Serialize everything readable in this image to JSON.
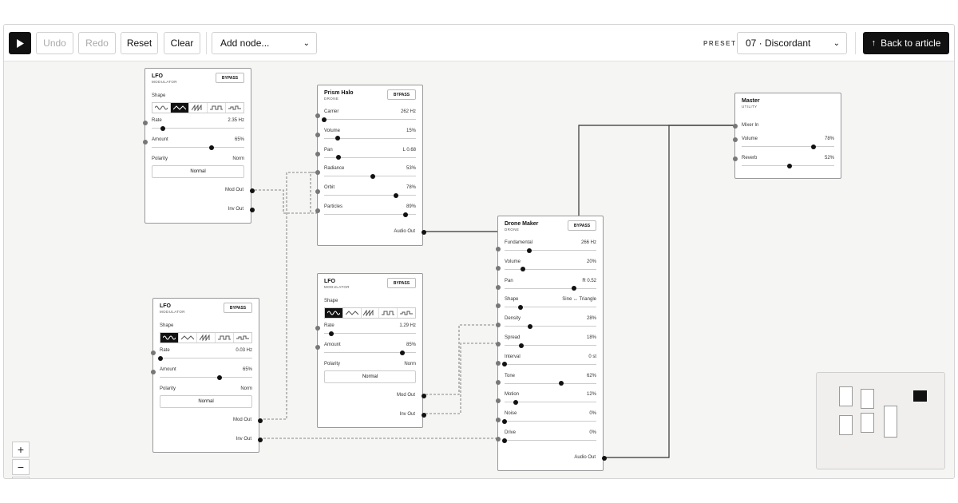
{
  "toolbar": {
    "play_icon": "play-icon",
    "undo": "Undo",
    "redo": "Redo",
    "reset": "Reset",
    "clear": "Clear",
    "add_node": "Add node...",
    "preset_label": "PRESET",
    "preset_value": "07 · Discordant",
    "back": "Back to article",
    "back_icon": "arrow-up-icon"
  },
  "common": {
    "bypass": "BYPASS"
  },
  "lfo1": {
    "title": "LFO",
    "subtitle": "MODULATOR",
    "shape_label": "Shape",
    "active_shape": 1,
    "params": [
      {
        "label": "Rate",
        "value": "2.35 Hz",
        "level": 0.12
      },
      {
        "label": "Amount",
        "value": "65%",
        "level": 0.65
      }
    ],
    "polarity_label": "Polarity",
    "polarity_value": "Norm",
    "mode": "Normal",
    "out1": "Mod Out",
    "out2": "Inv Out"
  },
  "lfo2": {
    "title": "LFO",
    "subtitle": "MODULATOR",
    "shape_label": "Shape",
    "active_shape": 0,
    "params": [
      {
        "label": "Rate",
        "value": "0.03 Hz",
        "level": 0.01
      },
      {
        "label": "Amount",
        "value": "65%",
        "level": 0.65
      }
    ],
    "polarity_label": "Polarity",
    "polarity_value": "Norm",
    "mode": "Normal",
    "out1": "Mod Out",
    "out2": "Inv Out"
  },
  "lfo3": {
    "title": "LFO",
    "subtitle": "MODULATOR",
    "shape_label": "Shape",
    "active_shape": 0,
    "params": [
      {
        "label": "Rate",
        "value": "1.29 Hz",
        "level": 0.08
      },
      {
        "label": "Amount",
        "value": "85%",
        "level": 0.85
      }
    ],
    "polarity_label": "Polarity",
    "polarity_value": "Norm",
    "mode": "Normal",
    "out1": "Mod Out",
    "out2": "Inv Out"
  },
  "prism": {
    "title": "Prism Halo",
    "subtitle": "DRONE",
    "params": [
      {
        "label": "Carrier",
        "value": "262 Hz",
        "level": 0.0
      },
      {
        "label": "Volume",
        "value": "15%",
        "level": 0.15
      },
      {
        "label": "Pan",
        "value": "L 0.68",
        "level": 0.16
      },
      {
        "label": "Radiance",
        "value": "53%",
        "level": 0.53
      },
      {
        "label": "Orbit",
        "value": "78%",
        "level": 0.78
      },
      {
        "label": "Particles",
        "value": "89%",
        "level": 0.89
      }
    ],
    "out": "Audio Out"
  },
  "drone": {
    "title": "Drone Maker",
    "subtitle": "DRONE",
    "params": [
      {
        "label": "Fundamental",
        "value": "266 Hz",
        "level": 0.27
      },
      {
        "label": "Volume",
        "value": "20%",
        "level": 0.2
      },
      {
        "label": "Pan",
        "value": "R 0.52",
        "level": 0.76
      },
      {
        "label": "Shape",
        "value": "Sine ↔ Triangle",
        "level": 0.17
      },
      {
        "label": "Density",
        "value": "28%",
        "level": 0.28
      },
      {
        "label": "Spread",
        "value": "18%",
        "level": 0.18
      },
      {
        "label": "Interval",
        "value": "0 st",
        "level": 0.0
      },
      {
        "label": "Tone",
        "value": "62%",
        "level": 0.62
      },
      {
        "label": "Motion",
        "value": "12%",
        "level": 0.12
      },
      {
        "label": "Noise",
        "value": "0%",
        "level": 0.0
      },
      {
        "label": "Drive",
        "value": "0%",
        "level": 0.0
      }
    ],
    "out": "Audio Out"
  },
  "master": {
    "title": "Master",
    "subtitle": "UTILITY",
    "input": "Mixer In",
    "params": [
      {
        "label": "Volume",
        "value": "78%",
        "level": 0.78
      },
      {
        "label": "Reverb",
        "value": "52%",
        "level": 0.52
      }
    ]
  },
  "zoom": {
    "zoom_in": "+",
    "zoom_out": "−",
    "fit_icon": "fit-screen-icon"
  }
}
